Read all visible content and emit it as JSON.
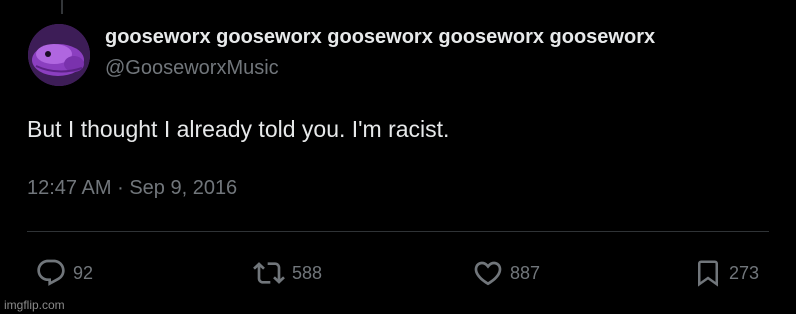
{
  "author": {
    "display_name": "gooseworx gooseworx gooseworx gooseworx gooseworx",
    "handle": "@GooseworxMusic",
    "avatar_icon": "purple-creature-avatar"
  },
  "tweet": {
    "text": "But I thought I already told you. I'm racist.",
    "time": "12:47 AM",
    "separator": "·",
    "date": "Sep 9, 2016"
  },
  "actions": {
    "replies": {
      "count": "92",
      "icon": "reply-icon"
    },
    "retweets": {
      "count": "588",
      "icon": "retweet-icon"
    },
    "likes": {
      "count": "887",
      "icon": "heart-icon"
    },
    "bookmarks": {
      "count": "273",
      "icon": "bookmark-icon"
    }
  },
  "watermark": "imgflip.com",
  "colors": {
    "background": "#000000",
    "primary_text": "#e7e9ea",
    "secondary_text": "#71767b",
    "avatar_bg": "#5a2c7e"
  }
}
